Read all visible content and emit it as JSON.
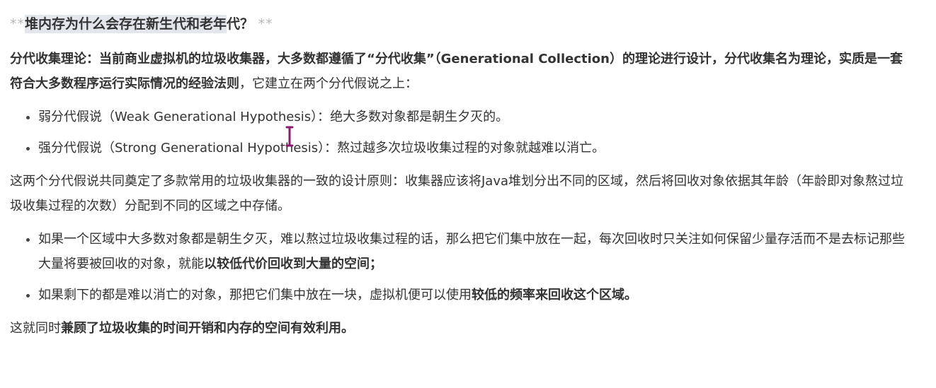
{
  "heading": {
    "md_prefix": "**",
    "selected_text": "堆内存为什么会存在新生代和老年",
    "rest_text": "代？",
    "md_suffix": "**"
  },
  "intro": {
    "bold_part": "分代收集理论：当前商业虚拟机的垃圾收集器，大多数都遵循了“分代收集”（Generational Collection）的理论进行设计，分代收集名为理论，实质是一套符合大多数程序运行实际情况的经验法则",
    "rest": "，它建立在两个分代假说之上："
  },
  "hypotheses": [
    {
      "text": "弱分代假说（Weak Generational Hypothesis）：绝大多数对象都是朝生夕灭的。"
    },
    {
      "text": "强分代假说（Strong Generational Hypothesis）：熬过越多次垃圾收集过程的对象就越难以消亡。"
    }
  ],
  "principle": {
    "text": "这两个分代假说共同奠定了多款常用的垃圾收集器的一致的设计原则：收集器应该将Java堆划分出不同的区域，然后将回收对象依据其年龄（年龄即对象熬过垃圾收集过程的次数）分配到不同的区域之中存储。"
  },
  "rules": [
    {
      "normal": "如果一个区域中大多数对象都是朝生夕灭，难以熬过垃圾收集过程的话，那么把它们集中放在一起，每次回收时只关注如何保留少量存活而不是去标记那些大量将要被回收的对象，就能",
      "bold": "以较低代价回收到大量的空间；"
    },
    {
      "normal": "如果剩下的都是难以消亡的对象，那把它们集中放在一块，虚拟机便可以使用",
      "bold": "较低的频率来回收这个区域。"
    }
  ],
  "conclusion": {
    "normal": "这就同时",
    "bold": "兼顾了垃圾收集的时间开销和内存的空间有效利用。"
  },
  "colors": {
    "text": "#333333",
    "markdown_mark": "#b9b9b9",
    "selection": "#e3e7ed",
    "cursor": "#8b1d6e"
  },
  "icons": {
    "cursor": "text-cursor-icon"
  }
}
